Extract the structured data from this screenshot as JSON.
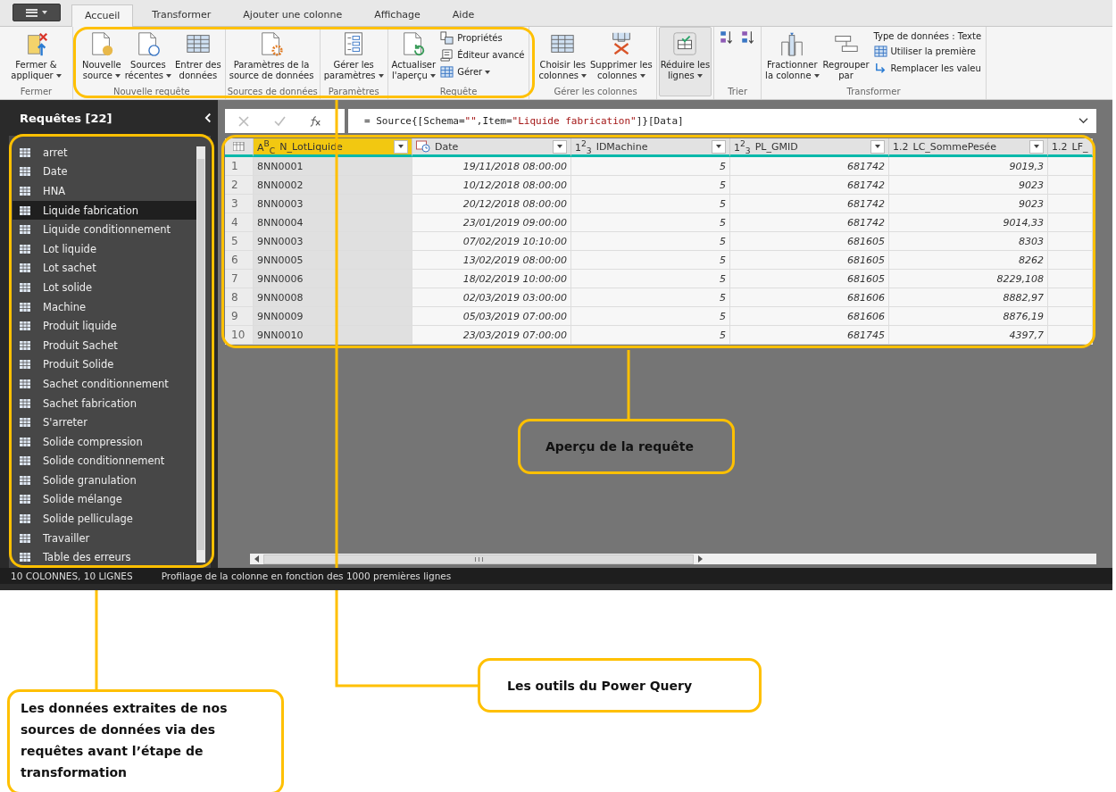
{
  "tabs": [
    {
      "label": "Accueil",
      "selected": true
    },
    {
      "label": "Transformer",
      "selected": false
    },
    {
      "label": "Ajouter une colonne",
      "selected": false
    },
    {
      "label": "Affichage",
      "selected": false
    },
    {
      "label": "Aide",
      "selected": false
    }
  ],
  "ribbon": {
    "groups": [
      {
        "label": "Fermer",
        "buttons": [
          {
            "label": "Fermer &\nappliquer",
            "kind": "large",
            "dropdown": true
          }
        ]
      },
      {
        "label": "Nouvelle requête",
        "buttons": [
          {
            "label": "Nouvelle\nsource",
            "kind": "large",
            "dropdown": true
          },
          {
            "label": "Sources\nrécentes",
            "kind": "large",
            "dropdown": true
          },
          {
            "label": "Entrer des\ndonnées",
            "kind": "large",
            "dropdown": false
          }
        ]
      },
      {
        "label": "Sources de données",
        "buttons": [
          {
            "label": "Paramètres de la\nsource de données",
            "kind": "large",
            "dropdown": false
          }
        ]
      },
      {
        "label": "Paramètres",
        "buttons": [
          {
            "label": "Gérer les\nparamètres",
            "kind": "large",
            "dropdown": true
          }
        ]
      },
      {
        "label": "Requête",
        "buttons": [
          {
            "label": "Actualiser\nl'aperçu",
            "kind": "large",
            "dropdown": true
          },
          {
            "label": "Propriétés",
            "kind": "small",
            "dropdown": false
          },
          {
            "label": "Éditeur avancé",
            "kind": "small",
            "dropdown": false
          },
          {
            "label": "Gérer",
            "kind": "small",
            "dropdown": true
          }
        ]
      },
      {
        "label": "Gérer les colonnes",
        "buttons": [
          {
            "label": "Choisir les\ncolonnes",
            "kind": "large",
            "dropdown": true
          },
          {
            "label": "Supprimer les\ncolonnes",
            "kind": "large",
            "dropdown": true
          }
        ]
      },
      {
        "buttons": [
          {
            "label": "Réduire les\nlignes",
            "kind": "large",
            "dropdown": true,
            "highlighted": true
          }
        ]
      },
      {
        "label": "Trier",
        "buttons": [
          {
            "kind": "icon"
          },
          {
            "kind": "icon"
          }
        ]
      },
      {
        "label": "Transformer",
        "buttons": [
          {
            "label": "Fractionner\nla colonne",
            "kind": "large",
            "dropdown": true
          },
          {
            "label": "Regrouper\npar",
            "kind": "large",
            "dropdown": false
          },
          {
            "label": "Type de données : Texte",
            "kind": "small",
            "dropdown": false
          },
          {
            "label": "Utiliser la première",
            "kind": "small",
            "dropdown": false
          },
          {
            "label": "Remplacer les valeu",
            "kind": "small",
            "dropdown": false
          }
        ]
      }
    ]
  },
  "sidebar": {
    "title": "Requêtes [22]",
    "items": [
      {
        "label": "arret",
        "selected": false
      },
      {
        "label": "Date",
        "selected": false
      },
      {
        "label": "HNA",
        "selected": false
      },
      {
        "label": "Liquide fabrication",
        "selected": true
      },
      {
        "label": "Liquide conditionnement",
        "selected": false
      },
      {
        "label": "Lot liquide",
        "selected": false
      },
      {
        "label": "Lot sachet",
        "selected": false
      },
      {
        "label": "Lot solide",
        "selected": false
      },
      {
        "label": "Machine",
        "selected": false
      },
      {
        "label": "Produit liquide",
        "selected": false
      },
      {
        "label": "Produit Sachet",
        "selected": false
      },
      {
        "label": "Produit Solide",
        "selected": false
      },
      {
        "label": "Sachet conditionnement",
        "selected": false
      },
      {
        "label": "Sachet fabrication",
        "selected": false
      },
      {
        "label": "S'arreter",
        "selected": false
      },
      {
        "label": "Solide compression",
        "selected": false
      },
      {
        "label": "Solide conditionnement",
        "selected": false
      },
      {
        "label": "Solide granulation",
        "selected": false
      },
      {
        "label": "Solide mélange",
        "selected": false
      },
      {
        "label": "Solide pelliculage",
        "selected": false
      },
      {
        "label": "Travailler",
        "selected": false
      },
      {
        "label": "Table des erreurs",
        "selected": false
      }
    ]
  },
  "formula": {
    "parts": [
      {
        "text": "= Source{[Schema=",
        "kind": "code"
      },
      {
        "text": "\"\"",
        "kind": "string"
      },
      {
        "text": ",Item=",
        "kind": "code"
      },
      {
        "text": "\"Liquide fabrication\"",
        "kind": "string"
      },
      {
        "text": "]}[Data]",
        "kind": "code"
      }
    ]
  },
  "table": {
    "columns": [
      {
        "kind": "index"
      },
      {
        "name": "N_LotLiquide",
        "kind": "text",
        "type_mark": "A$^{B}$$_{C}$",
        "selected": true
      },
      {
        "name": "Date",
        "kind": "datetime",
        "selected": false
      },
      {
        "name": "IDMachine",
        "kind": "number",
        "type_mark": "1$^{2}$$_{3}$",
        "selected": false
      },
      {
        "name": "PL_GMID",
        "kind": "number",
        "type_mark": "1$^{2}$$_{3}$",
        "selected": false
      },
      {
        "name": "LC_SommePesée",
        "kind": "number",
        "type_mark": "1.2",
        "selected": false
      },
      {
        "name": "LF_",
        "kind": "number",
        "type_mark": "1.2",
        "selected": false
      }
    ],
    "rows": [
      [
        "1",
        "8NN0001",
        "19/11/2018 08:00:00",
        "5",
        "681742",
        "9019,3"
      ],
      [
        "2",
        "8NN0002",
        "10/12/2018 08:00:00",
        "5",
        "681742",
        "9023"
      ],
      [
        "3",
        "8NN0003",
        "20/12/2018 08:00:00",
        "5",
        "681742",
        "9023"
      ],
      [
        "4",
        "8NN0004",
        "23/01/2019 09:00:00",
        "5",
        "681742",
        "9014,33"
      ],
      [
        "5",
        "9NN0003",
        "07/02/2019 10:10:00",
        "5",
        "681605",
        "8303"
      ],
      [
        "6",
        "9NN0005",
        "13/02/2019 08:00:00",
        "5",
        "681605",
        "8262"
      ],
      [
        "7",
        "9NN0006",
        "18/02/2019 10:00:00",
        "5",
        "681605",
        "8229,108"
      ],
      [
        "8",
        "9NN0008",
        "02/03/2019 03:00:00",
        "5",
        "681606",
        "8882,97"
      ],
      [
        "9",
        "9NN0009",
        "05/03/2019 07:00:00",
        "5",
        "681606",
        "8876,19"
      ],
      [
        "10",
        "9NN0010",
        "23/03/2019 07:00:00",
        "5",
        "681745",
        "4397,7"
      ]
    ]
  },
  "status_bar": {
    "counts": "10 COLONNES, 10 LIGNES",
    "profiling": "Profilage de la colonne en fonction des 1000 premières lignes"
  },
  "annotations": [
    {
      "text": "Aperçu de la requête"
    },
    {
      "text": "Les outils du Power Query"
    },
    {
      "text": "Les données extraites de nos sources de données via des requêtes avant l’étape de transformation"
    }
  ]
}
